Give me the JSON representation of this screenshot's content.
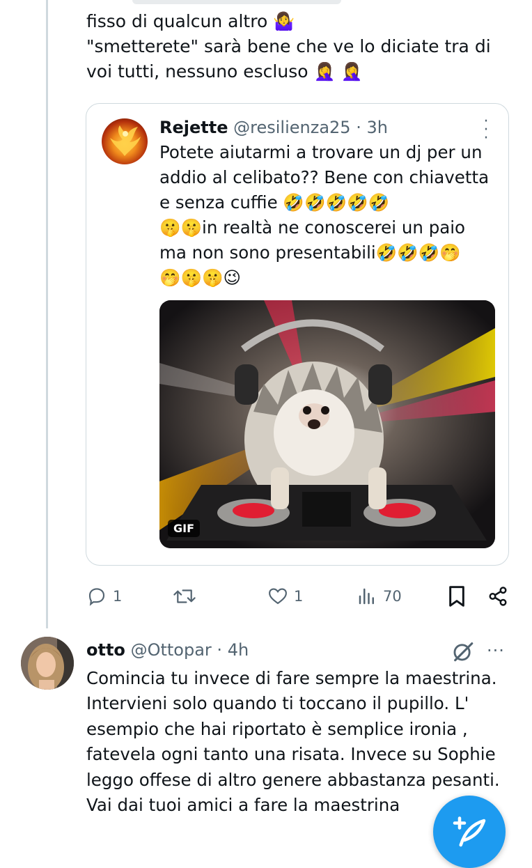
{
  "tweet": {
    "text": "fisso di qualcun altro 🤷‍♀️\n\"smetterete\" sarà bene che ve lo diciate tra di voi tutti, nessuno escluso 🤦‍♀️ 🤦‍♀️"
  },
  "quote": {
    "name": "Rejette",
    "handle": "@resilienza25",
    "separator": "·",
    "time": "3h",
    "text": "Potete aiutarmi a trovare un dj per un addio al celibato??  Bene con chiavetta e senza cuffie 🤣🤣🤣🤣🤣\n🤫🤫in realtà ne conoscerei un paio ma non sono presentabili🤣🤣🤣🤭\n🤭🤫🤫😉",
    "media_badge": "GIF"
  },
  "actions": {
    "replies": "1",
    "likes": "1",
    "views": "70"
  },
  "reply": {
    "name": "otto",
    "handle": "@Ottopar",
    "separator": "·",
    "time": "4h",
    "more": "···",
    "text": "Comincia tu invece di fare sempre la maestrina. Intervieni solo quando ti toccano il pupillo. L' esempio che hai riportato è semplice ironia , fatevela ogni tanto una risata. Invece su Sophie leggo offese di altro genere abbastanza pesanti. Vai dai tuoi amici a fare la maestrina"
  },
  "colors": {
    "accent": "#1d9bf0",
    "text": "#0f1419",
    "secondary": "#536471",
    "border": "#cfd9de"
  },
  "icons": [
    "reply-icon",
    "retweet-icon",
    "like-icon",
    "views-icon",
    "bookmark-icon",
    "share-icon",
    "more-icon",
    "grok-icon",
    "compose-icon"
  ]
}
